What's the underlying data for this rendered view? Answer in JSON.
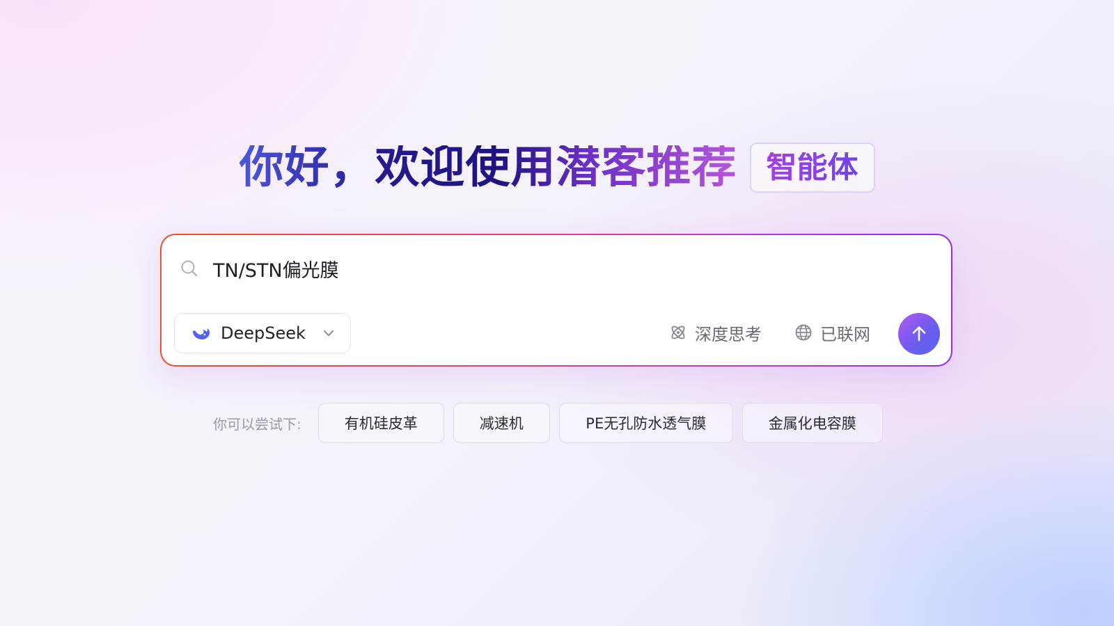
{
  "headline": {
    "title": "你好，欢迎使用潜客推荐",
    "badge": "智能体"
  },
  "search": {
    "query": "TN/STN偏光膜",
    "placeholder": "",
    "model_label": "DeepSeek",
    "deep_think_label": "深度思考",
    "web_label": "已联网"
  },
  "suggestions": {
    "label": "你可以尝试下:",
    "items": [
      "有机硅皮革",
      "减速机",
      "PE无孔防水透气膜",
      "金属化电容膜"
    ]
  },
  "colors": {
    "accent_blue": "#5f66f2",
    "accent_purple": "#b158ef",
    "border_orange": "#f0512d",
    "border_violet": "#8b2fe6"
  },
  "icons": {
    "search": "search-icon",
    "model": "deepseek-whale-icon",
    "dropdown": "chevron-down-icon",
    "deep_think": "atom-icon",
    "web": "globe-icon",
    "send": "arrow-up-icon"
  }
}
